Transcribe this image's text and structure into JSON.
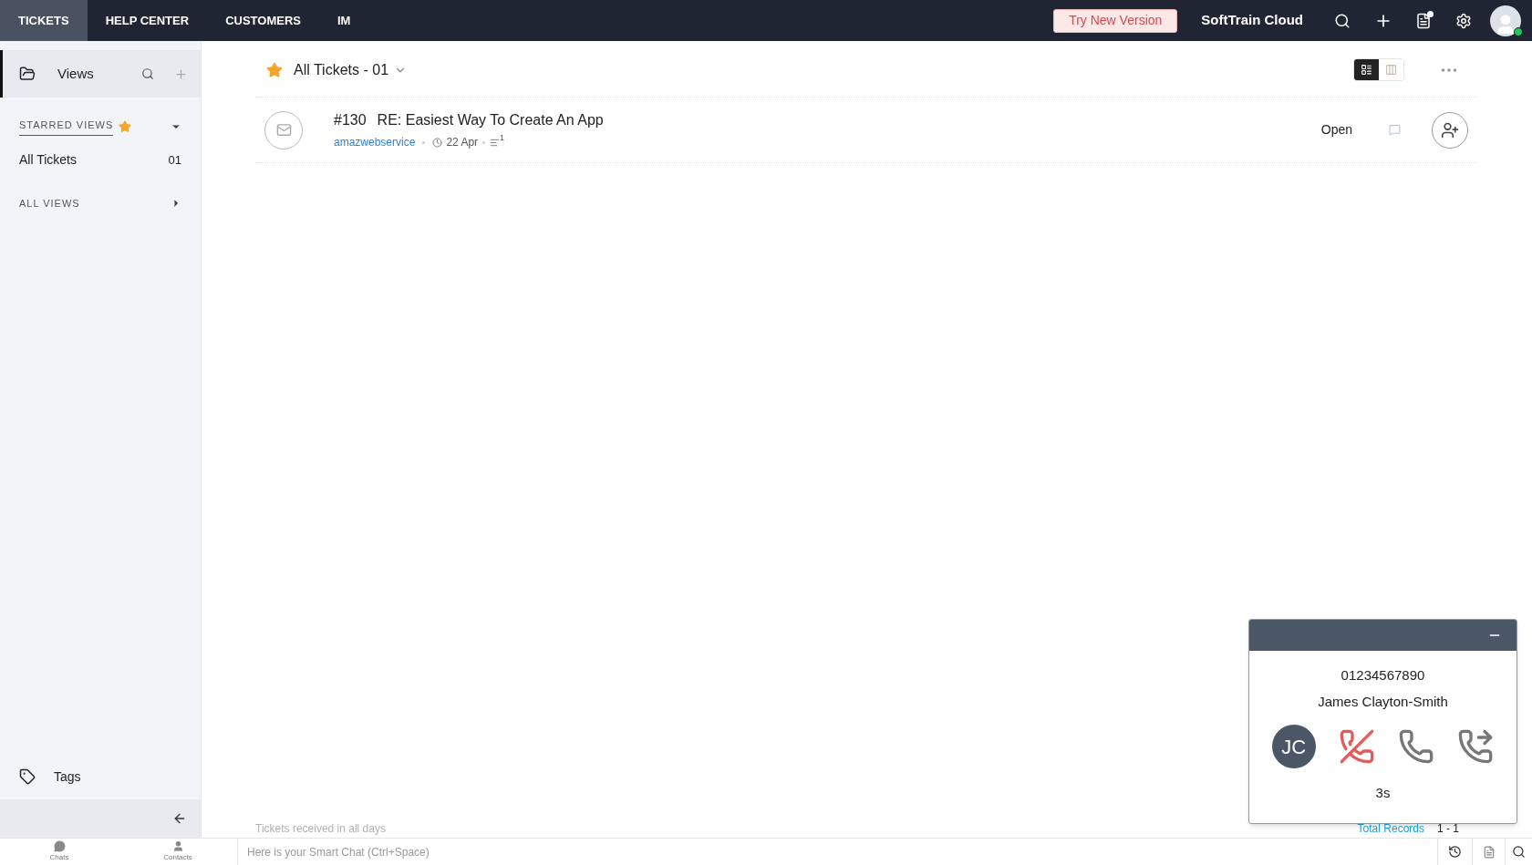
{
  "top_nav": {
    "tabs": [
      {
        "label": "TICKETS",
        "selected": true
      },
      {
        "label": "HELP CENTER",
        "selected": false
      },
      {
        "label": "CUSTOMERS",
        "selected": false
      },
      {
        "label": "IM",
        "selected": false
      }
    ],
    "try_button": "Try New Version",
    "org_name": "SoftTrain Cloud",
    "notification_dot": true,
    "user_online": true
  },
  "sidebar": {
    "header": "Views",
    "starred_views": {
      "label": "STARRED VIEWS",
      "expanded": true,
      "items": [
        {
          "label": "All Tickets",
          "count": "01",
          "selected": false
        }
      ]
    },
    "all_views": {
      "label": "ALL VIEWS",
      "expanded": false
    },
    "tags": "Tags"
  },
  "main": {
    "view_title": "All Tickets - 01",
    "starred": true,
    "layout_toggle": [
      {
        "kind": "list",
        "selected": true
      },
      {
        "kind": "board",
        "selected": false
      }
    ],
    "tickets": [
      {
        "number": "#130",
        "subject": "RE: Easiest Way To Create An App",
        "contact": "amazwebservice",
        "date": "22 Apr",
        "thread_count": "1",
        "status": "Open"
      }
    ],
    "footer_note": "Tickets received in all days",
    "total_label": "Total Records",
    "total_range": "1 - 1"
  },
  "call_widget": {
    "phone": "01234567890",
    "name": "James Clayton-Smith",
    "initials": "JC",
    "duration": "3s"
  },
  "bottom_bar": {
    "items": [
      {
        "kind": "chats",
        "label": "Chats"
      },
      {
        "kind": "contacts",
        "label": "Contacts"
      }
    ],
    "smart_chat_placeholder": "Here is your Smart Chat (Ctrl+Space)"
  }
}
